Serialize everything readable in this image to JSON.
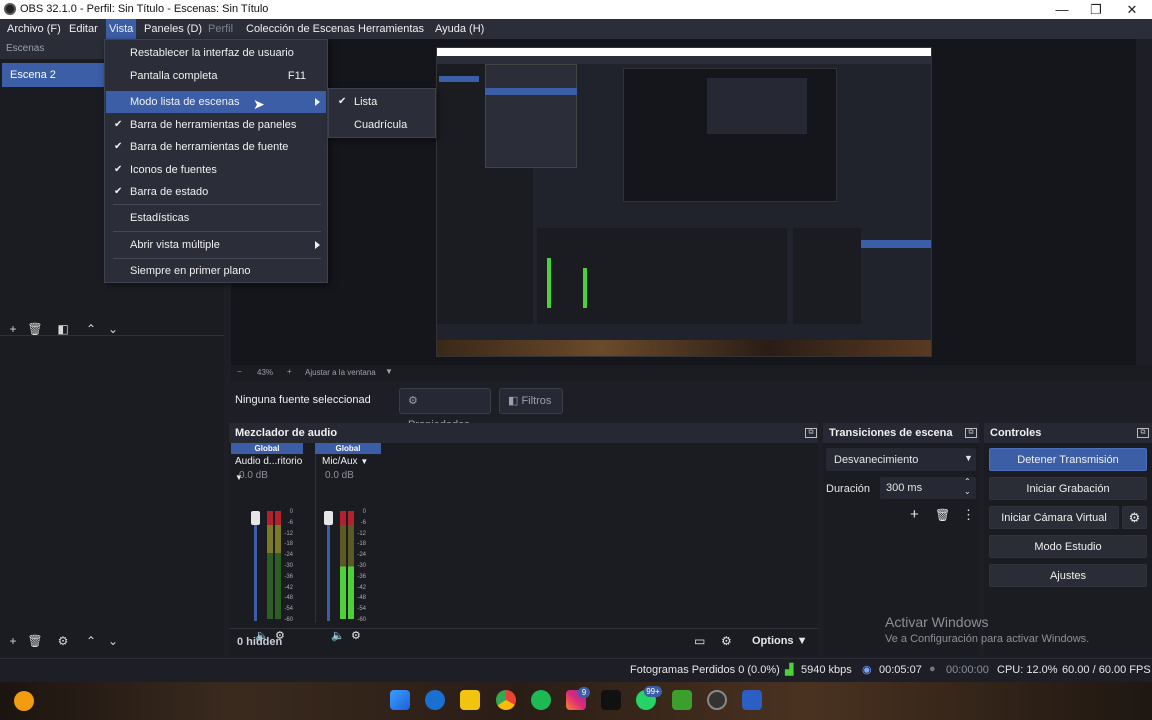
{
  "window": {
    "title": "OBS 32.1.0 - Perfil: Sin Título - Escenas: Sin Título",
    "minimize": "—",
    "maximize": "❐",
    "close": "✕"
  },
  "menubar": [
    "Archivo (F)",
    "Editar",
    "Vista",
    "Paneles (D)",
    "Perfil",
    "Colección de Escenas",
    "Herramientas",
    "Ayuda (H)"
  ],
  "scenes": {
    "header": "Escenas",
    "items": [
      "Escena 2"
    ]
  },
  "vista_menu": {
    "items": [
      {
        "label": "Restablecer la interfaz de usuario",
        "shortcut": "",
        "checked": false
      },
      {
        "label": "Pantalla completa",
        "shortcut": "F11",
        "checked": false
      },
      {
        "label": "Modo lista de escenas",
        "checked": false,
        "submenu": true,
        "highlighted": true
      },
      {
        "label": "Barra de herramientas de paneles",
        "checked": true
      },
      {
        "label": "Barra de herramientas de fuente",
        "checked": true
      },
      {
        "label": "Iconos de fuentes",
        "checked": true
      },
      {
        "label": "Barra de estado",
        "checked": true
      },
      {
        "label": "Estadísticas",
        "checked": false
      },
      {
        "label": "Abrir vista múltiple",
        "checked": false,
        "submenu": true
      },
      {
        "label": "Siempre en primer plano",
        "checked": false
      }
    ]
  },
  "scene_mode_submenu": {
    "items": [
      {
        "label": "Lista",
        "checked": true
      },
      {
        "label": "Cuadrícula",
        "checked": false
      }
    ]
  },
  "zoom_bar": {
    "minus": "−",
    "zoom": "43%",
    "plus": "+",
    "fit": "Ajustar a la ventana"
  },
  "source_bar": {
    "no_source": "Ninguna fuente seleccionad",
    "properties": "Propiedades",
    "filters": "Filtros"
  },
  "mixer": {
    "title": "Mezclador de audio",
    "channels": [
      {
        "global": "Global",
        "name": "Audio d...ritorio",
        "db": "0.0 dB",
        "level": 0.62
      },
      {
        "global": "Global",
        "name": "Mic/Aux",
        "db": "0.0 dB",
        "level": 0.48
      }
    ],
    "scale": [
      "0",
      "-6",
      "-12",
      "-18",
      "-24",
      "-30",
      "-36",
      "-42",
      "-48",
      "-54",
      "-60"
    ],
    "hidden": "0 hidden",
    "options": "Options"
  },
  "transitions": {
    "title": "Transiciones de escena",
    "selected": "Desvanecimiento",
    "duration_label": "Duración",
    "duration_value": "300 ms"
  },
  "controls": {
    "title": "Controles",
    "buttons": [
      "Detener Transmisión",
      "Iniciar Grabación",
      "Iniciar Cámara Virtual",
      "Modo Estudio",
      "Ajustes"
    ]
  },
  "activate": {
    "line1": "Activar Windows",
    "line2": "Ve a Configuración para activar Windows."
  },
  "status": {
    "dropped": "Fotogramas Perdidos 0 (0.0%)",
    "bitrate": "5940 kbps",
    "stream_time": "00:05:07",
    "rec_time": "00:00:00",
    "cpu": "CPU: 12.0%",
    "fps": "60.00 / 60.00 FPS"
  },
  "taskbar": {
    "badge_insta": "9",
    "badge_chat": "99+"
  },
  "colors": {
    "accent": "#3c5ea7",
    "background": "#1e1f26",
    "panel": "#1b1c22",
    "meter_green": "#4cd137",
    "meter_red": "#b3202e"
  }
}
